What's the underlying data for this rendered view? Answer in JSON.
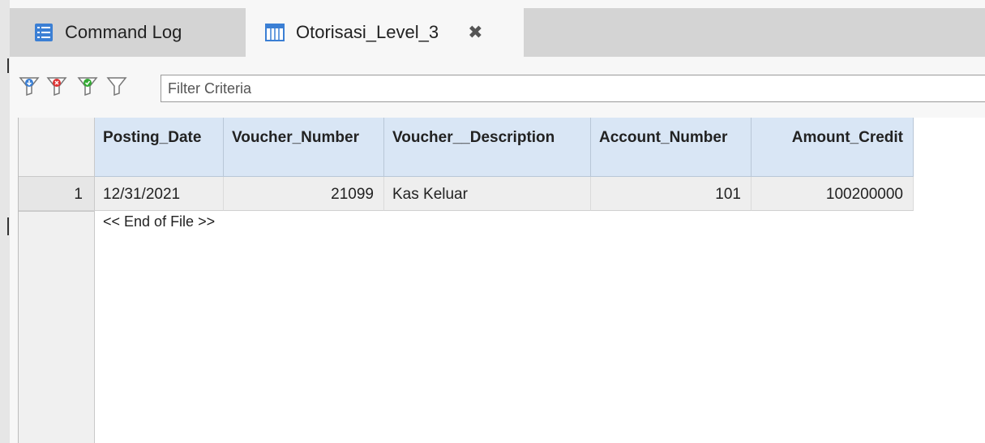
{
  "tabs": [
    {
      "label": "Command Log",
      "icon": "list-icon",
      "active": false
    },
    {
      "label": "Otorisasi_Level_3",
      "icon": "table-icon",
      "active": true
    }
  ],
  "tab_close_glyph": "✖",
  "filter": {
    "placeholder": "Filter Criteria",
    "buttons": [
      "filter-add-icon",
      "filter-remove-icon",
      "filter-apply-icon",
      "filter-icon"
    ]
  },
  "grid": {
    "columns": [
      "Posting_Date",
      "Voucher_Number",
      "Voucher__Description",
      "Account_Number",
      "Amount_Credit"
    ],
    "rows": [
      {
        "num": "1",
        "cells": [
          "12/31/2021",
          "21099",
          "Kas Keluar",
          "101",
          "100200000"
        ]
      }
    ],
    "end_of_file": "<< End of File >>"
  },
  "colors": {
    "header_bg": "#d9e6f5",
    "tab_inactive": "#d4d4d4",
    "tab_active": "#f7f7f7",
    "icon_blue": "#3b7fd4",
    "filter_red": "#d33",
    "filter_green": "#3a3"
  }
}
